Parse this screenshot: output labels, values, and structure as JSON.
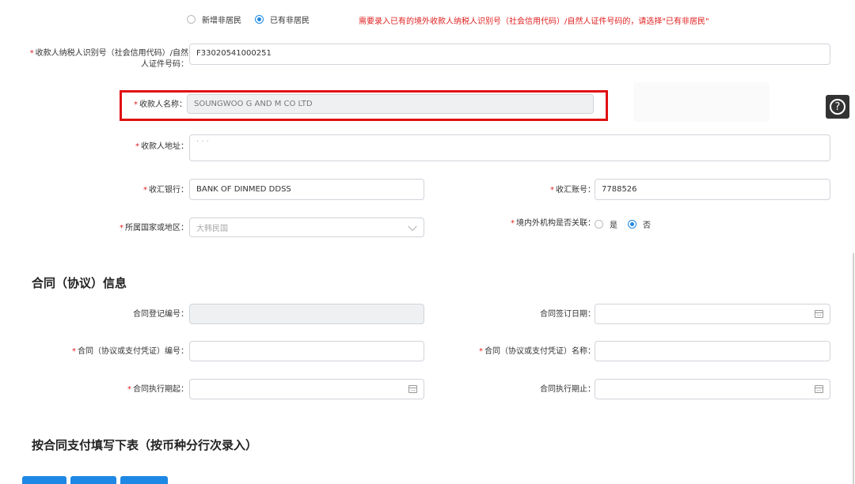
{
  "resident_type": {
    "option_new": "新增非居民",
    "option_existing": "已有非居民",
    "notice": "需要录入已有的境外收款人纳税人识别号（社会信用代码）/自然人证件号码的，请选择\"已有非居民\""
  },
  "payee": {
    "taxid_label_line1": "收款人纳税人识别号（社会信用代码）/自然",
    "taxid_label_line2": "人证件号码：",
    "taxid_value": "F33020541000251",
    "name_label": "收款人名称：",
    "name_value": "SOUNGWOO G AND M CO LTD",
    "address_label": "收款人地址：",
    "address_value": "· · ·",
    "bank_label": "收汇银行：",
    "bank_value": "BANK OF DINMED DDSS",
    "account_label": "收汇账号：",
    "account_value": "7788526",
    "country_label": "所属国家或地区：",
    "country_value": "大韩民国",
    "related_label": "境内外机构是否关联：",
    "related_yes": "是",
    "related_no": "否"
  },
  "help": {
    "glyph": "?"
  },
  "contract": {
    "section_title": "合同（协议）信息",
    "reg_no_label": "合同登记编号：",
    "sign_date_label": "合同签订日期：",
    "contract_no_label": "合同（协议或支付凭证）编号：",
    "contract_name_label": "合同（协议或支付凭证）名称：",
    "start_label": "合同执行期起：",
    "end_label": "合同执行期止："
  },
  "payment": {
    "section_title": "按合同支付填写下表（按币种分行次录入）"
  },
  "colors": {
    "accent": "#1e88e5",
    "required": "#e02020",
    "highlight": "#e01010"
  }
}
